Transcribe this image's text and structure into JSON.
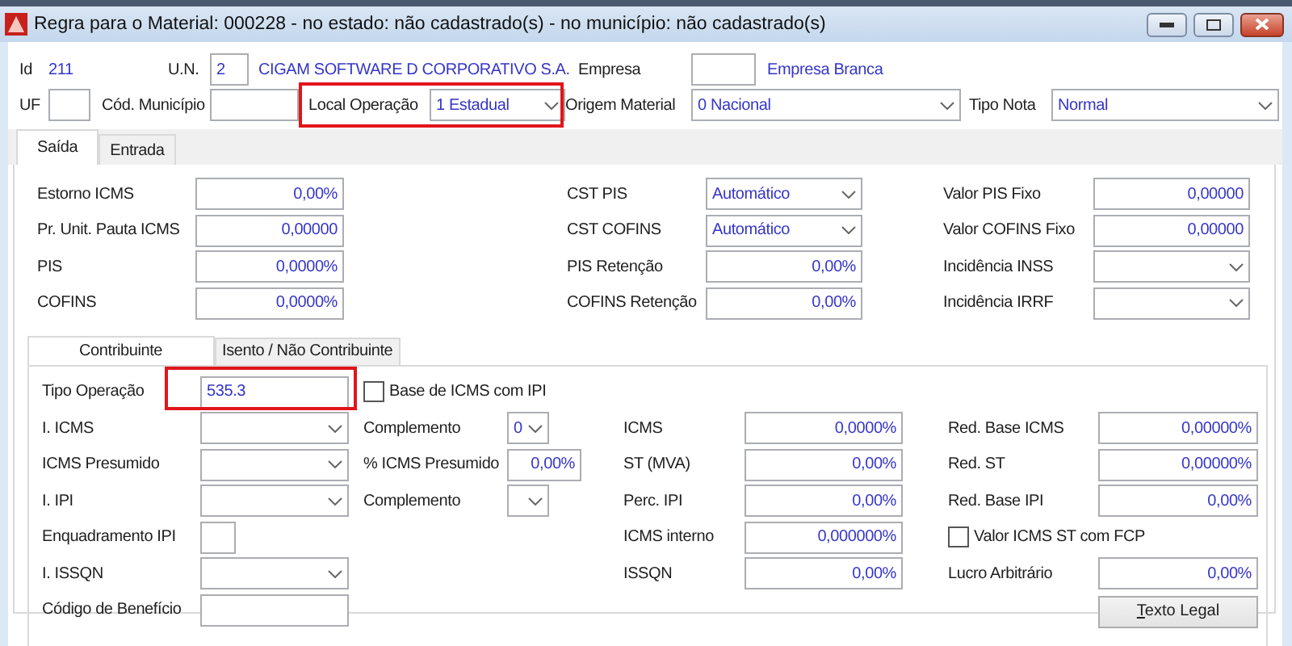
{
  "window": {
    "title": "Regra para o Material: 000228 - no estado: não cadastrado(s) - no município: não cadastrado(s)"
  },
  "header": {
    "rows": [
      [
        {
          "kind": "label",
          "text": "Id"
        },
        {
          "kind": "link",
          "text": "211"
        },
        {
          "kind": "label",
          "text": "U.N."
        },
        {
          "kind": "input",
          "value": "2"
        },
        {
          "kind": "link",
          "text": "CIGAM SOFTWARE D CORPORATIVO S.A."
        },
        {
          "kind": "label",
          "text": "Empresa"
        },
        {
          "kind": "input"
        },
        {
          "kind": "link",
          "text": "Empresa Branca"
        }
      ],
      [
        {
          "kind": "label",
          "text": "UF"
        },
        {
          "kind": "input"
        },
        {
          "kind": "label",
          "text": "Cód. Município"
        },
        {
          "kind": "input"
        },
        {
          "kind": "group",
          "highlighted": true,
          "items": [
            {
              "kind": "label",
              "text": "Local Operação"
            },
            {
              "kind": "select",
              "value": "1 Estadual"
            }
          ]
        },
        {
          "kind": "label",
          "text": "Origem Material"
        },
        {
          "kind": "select",
          "value": "0 Nacional"
        },
        {
          "kind": "label",
          "text": "Tipo Nota"
        },
        {
          "kind": "select",
          "value": "Normal"
        }
      ]
    ]
  },
  "tabs": [
    {
      "label": "Saída",
      "selected": true
    },
    {
      "label": "Entrada",
      "selected": false
    }
  ],
  "saida": {
    "rows": [
      [
        {
          "label": "Estorno ICMS",
          "kind": "number",
          "value": "0,00%"
        },
        {
          "label": "CST PIS",
          "kind": "select",
          "value": "Automático"
        },
        {
          "label": "Valor PIS Fixo",
          "kind": "number",
          "value": "0,00000"
        }
      ],
      [
        {
          "label": "Pr. Unit. Pauta ICMS",
          "kind": "number",
          "value": "0,00000"
        },
        {
          "label": "CST COFINS",
          "kind": "select",
          "value": "Automático"
        },
        {
          "label": "Valor COFINS Fixo",
          "kind": "number",
          "value": "0,00000"
        }
      ],
      [
        {
          "label": "PIS",
          "kind": "number",
          "value": "0,0000%"
        },
        {
          "label": "PIS Retenção",
          "kind": "number",
          "value": "0,00%"
        },
        {
          "label": "Incidência INSS",
          "kind": "select"
        }
      ],
      [
        {
          "label": "COFINS",
          "kind": "number",
          "value": "0,0000%"
        },
        {
          "label": "COFINS Retenção",
          "kind": "number",
          "value": "0,00%"
        },
        {
          "label": "Incidência IRRF",
          "kind": "select"
        }
      ]
    ]
  },
  "subtabs": [
    {
      "label": "Contribuinte",
      "selected": true
    },
    {
      "label": "Isento / Não Contribuinte",
      "selected": false
    }
  ],
  "contribuinte": {
    "rows": [
      [
        {
          "label": "Tipo Operação",
          "kind": "text",
          "value": "535.3",
          "highlighted": true
        },
        {
          "kind": "checkbox",
          "label": "Base de ICMS com IPI",
          "checked": false
        },
        null,
        null
      ],
      [
        {
          "label": "I. ICMS",
          "kind": "select"
        },
        {
          "label": "Complemento",
          "kind": "small-select",
          "value": "0"
        },
        {
          "label": "ICMS",
          "kind": "number",
          "value": "0,0000%"
        },
        {
          "label": "Red. Base ICMS",
          "kind": "number",
          "value": "0,00000%"
        }
      ],
      [
        {
          "label": "ICMS Presumido",
          "kind": "select"
        },
        {
          "label": "% ICMS Presumido",
          "kind": "small-number",
          "value": "0,00%"
        },
        {
          "label": "ST (MVA)",
          "kind": "number",
          "value": "0,00%"
        },
        {
          "label": "Red. ST",
          "kind": "number",
          "value": "0,00000%"
        }
      ],
      [
        {
          "label": "I. IPI",
          "kind": "select"
        },
        {
          "label": "Complemento",
          "kind": "small-select"
        },
        {
          "label": "Perc. IPI",
          "kind": "number",
          "value": "0,00%"
        },
        {
          "label": "Red. Base IPI",
          "kind": "number",
          "value": "0,00%"
        }
      ],
      [
        {
          "label": "Enquadramento IPI",
          "kind": "small-text"
        },
        null,
        {
          "label": "ICMS interno",
          "kind": "number",
          "value": "0,000000%"
        },
        {
          "kind": "checkbox",
          "label": "Valor ICMS ST com FCP",
          "checked": false
        }
      ],
      [
        {
          "label": "I. ISSQN",
          "kind": "select"
        },
        null,
        {
          "label": "ISSQN",
          "kind": "number",
          "value": "0,00%"
        },
        {
          "label": "Lucro Arbitrário",
          "kind": "number",
          "value": "0,00%"
        }
      ],
      [
        {
          "label": "Código de Benefício",
          "kind": "text"
        },
        null,
        null,
        {
          "kind": "button",
          "label": "Texto Legal"
        }
      ]
    ]
  }
}
